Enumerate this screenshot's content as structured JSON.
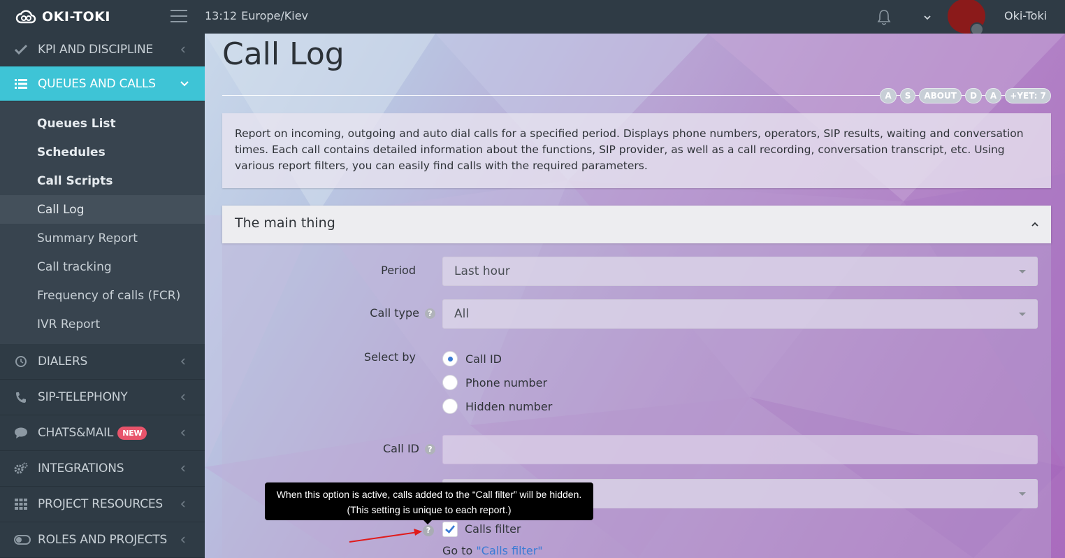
{
  "topbar": {
    "logo_text": "OKI-TOKI",
    "time": "13:12",
    "timezone": "Europe/Kiev",
    "username": "Oki-Toki"
  },
  "sidebar": {
    "items_top": [
      {
        "label": "KPI AND DISCIPLINE",
        "icon": "check-icon"
      },
      {
        "label": "QUEUES AND CALLS",
        "icon": "list-icon",
        "active": true
      }
    ],
    "submenu": [
      {
        "label": "Queues List",
        "bold": true
      },
      {
        "label": "Schedules",
        "bold": true
      },
      {
        "label": "Call Scripts",
        "bold": true
      },
      {
        "label": "Call Log",
        "current": true
      },
      {
        "label": "Summary Report"
      },
      {
        "label": "Call tracking"
      },
      {
        "label": "Frequency of calls (FCR)"
      },
      {
        "label": "IVR Report"
      }
    ],
    "items_bottom": [
      {
        "label": "DIALERS",
        "icon": "clock-icon"
      },
      {
        "label": "SIP-TELEPHONY",
        "icon": "phone-icon"
      },
      {
        "label": "CHATS&MAIL",
        "icon": "chat-icon",
        "badge": "NEW"
      },
      {
        "label": "INTEGRATIONS",
        "icon": "gears-icon"
      },
      {
        "label": "PROJECT RESOURCES",
        "icon": "grid-icon"
      },
      {
        "label": "ROLES AND PROJECTS",
        "icon": "toggle-icon"
      }
    ]
  },
  "main": {
    "title": "Call Log",
    "pills": [
      "A",
      "S",
      "ABOUT",
      "D",
      "A",
      "+YET: 7"
    ],
    "description": "Report on incoming, outgoing and auto dial calls for a specified period. Displays phone numbers, operators, SIP results, waiting and conversation times. Each call contains detailed information about the functions, SIP provider, as well as a call recording, conversation transcript, etc. Using various report filters, you can easily find calls with the required parameters.",
    "panel_title": "The main thing",
    "form": {
      "period_label": "Period",
      "period_value": "Last hour",
      "call_type_label": "Call type",
      "call_type_value": "All",
      "select_by_label": "Select by",
      "select_by_options": [
        {
          "label": "Call ID",
          "selected": true
        },
        {
          "label": "Phone number",
          "selected": false
        },
        {
          "label": "Hidden number",
          "selected": false
        }
      ],
      "call_id_label": "Call ID",
      "call_id_value": "",
      "calls_filter_label": "Calls filter",
      "calls_filter_checked": true,
      "goto_prefix": "Go to ",
      "goto_link": "\"Calls filter\""
    },
    "tooltip": "When this option is active, calls added to the “Call filter” will be hidden. (This setting is unique to each report.)",
    "help_glyph": "?"
  },
  "colors": {
    "sidebar_bg": "#2f3b45",
    "active_accent": "#3ec4d6",
    "badge_new": "#e8546b",
    "link": "#3a7bd5"
  }
}
